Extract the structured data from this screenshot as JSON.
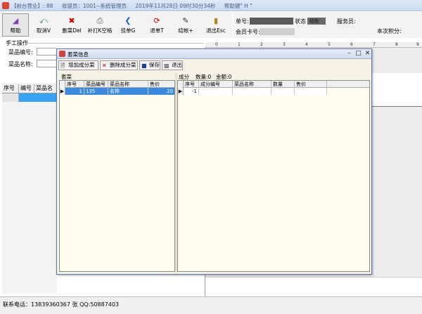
{
  "window": {
    "title_parts": [
      "【前台营业】: 88",
      "收银员：1001--系统管理员",
      "2019年11月28日 09时30分34秒",
      "帮助键\" H \""
    ]
  },
  "toolbar": {
    "buttons": [
      {
        "label": "帮助",
        "icon": "help-book-icon"
      },
      {
        "label": "取消V",
        "icon": "undo-arrow-icon"
      },
      {
        "label": "删菜Del",
        "icon": "delete-x-icon"
      },
      {
        "label": "补打K空格",
        "icon": "print-icon"
      },
      {
        "label": "挂单G",
        "icon": "left-arrow-icon"
      },
      {
        "label": "退单T",
        "icon": "refund-icon"
      },
      {
        "label": "结帐+",
        "icon": "checkout-icon"
      },
      {
        "label": "退出Esc",
        "icon": "exit-door-icon"
      }
    ]
  },
  "info": {
    "order_no_label": "单号:",
    "status_label": "状态",
    "status_value": "结帐",
    "waiter_label": "服务员:",
    "member_card_label": "会员卡号:",
    "points_label": "本次积分:"
  },
  "manual": {
    "title": "手工操作",
    "dish_code_label": "菜品编号:",
    "dish_name_label": "菜品名称:"
  },
  "ruler": [
    "0",
    "1",
    "2",
    "3",
    "4",
    "5",
    "6",
    "7",
    "8",
    "9"
  ],
  "order_grid": {
    "columns": [
      "序号",
      "编号",
      "菜品名"
    ]
  },
  "dialog": {
    "title": "套菜信息",
    "buttons": [
      "增加成分菜",
      "删除成分菜",
      "保存",
      "退出"
    ],
    "left_pane_label": "套菜",
    "left_columns": [
      "序号",
      "菜品编号",
      "菜品名称",
      "售价"
    ],
    "left_rows": [
      {
        "seq": "1",
        "code": "135",
        "name": "名称",
        "price": "20"
      }
    ],
    "right_pane_label": "成分",
    "right_count_label": "数量:0",
    "right_amount_label": "金额:0",
    "right_columns": [
      "序号",
      "成分编号",
      "菜品名称",
      "数量",
      "售价"
    ],
    "right_rows": [
      {
        "seq": "-1",
        "code": "",
        "name": "",
        "qty": "",
        "price": ""
      }
    ]
  },
  "statusbar": {
    "text": "联系电话：13839360367  张   QQ:50887403"
  }
}
